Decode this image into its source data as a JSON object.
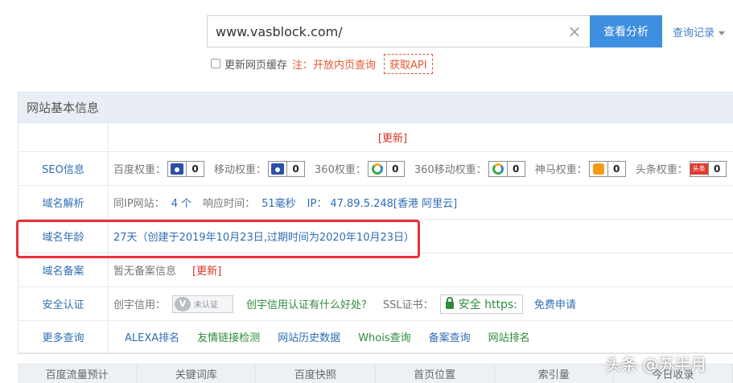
{
  "search": {
    "value": "www.vasblock.com/",
    "button": "查看分析",
    "history": "查询记录",
    "refresh_cache_label": "更新网页缓存",
    "note": "注：开放内页查询",
    "api_button": "获取API"
  },
  "panel": {
    "title": "网站基本信息",
    "update_link": "[更新]",
    "rows": {
      "seo": {
        "label": "SEO信息",
        "weights": [
          {
            "name": "百度权重：",
            "value": "0",
            "icon": "baidu-paw-icon"
          },
          {
            "name": "移动权重：",
            "value": "0",
            "icon": "baidu-paw-icon"
          },
          {
            "name": "360权重：",
            "value": "0",
            "icon": "360-ring-icon"
          },
          {
            "name": "360移动权重：",
            "value": "0",
            "icon": "360-ring-icon"
          },
          {
            "name": "神马权重：",
            "value": "0",
            "icon": "shenma-icon"
          },
          {
            "name": "头条权重：",
            "value": "0",
            "icon": "toutiao-icon"
          }
        ],
        "toutiao_icon_text": "头条"
      },
      "dns": {
        "label": "域名解析",
        "same_ip_label": "同IP网站：",
        "same_ip_value": "4 个",
        "response_label": "响应时间：",
        "response_value": "51毫秒",
        "ip_label": "IP：",
        "ip_value": "47.89.5.248[香港 阿里云]"
      },
      "age": {
        "label": "域名年龄",
        "value": "27天（创建于2019年10月23日,过期时间为2020年10月23日）"
      },
      "icp": {
        "label": "域名备案",
        "value": "暂无备案信息",
        "update": "[更新]"
      },
      "security": {
        "label": "安全认证",
        "credit_label": "创宇信用：",
        "credit_badge": "未认证",
        "credit_link": "创宇信用认证有什么好处?",
        "ssl_label": "SSL证书：",
        "ssl_badge": "安全 https:",
        "ssl_apply": "免费申请"
      },
      "more": {
        "label": "更多查询",
        "links": [
          "ALEXA排名",
          "友情链接检测",
          "网站历史数据",
          "Whois查询",
          "备案查询",
          "网站排名"
        ]
      }
    }
  },
  "bottom_tabs": [
    "百度流量预计",
    "关键词库",
    "百度快照",
    "首页位置",
    "索引量",
    "今日收录"
  ],
  "watermark": "头条 @苏半月",
  "colors": {
    "accent": "#3f8fe0",
    "link": "#2f6db5",
    "warning": "#e4582e",
    "highlight": "#e8303a",
    "green": "#2e8b3a"
  }
}
